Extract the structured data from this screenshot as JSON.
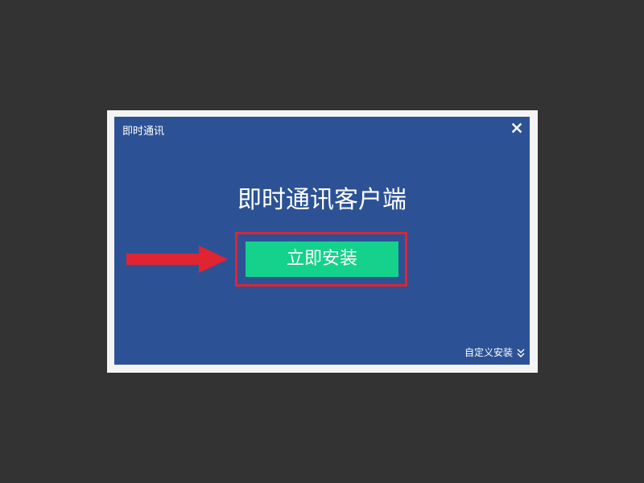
{
  "dialog": {
    "window_title": "即时通讯",
    "main_title": "即时通讯客户端",
    "install_button_label": "立即安装",
    "custom_install_label": "自定义安装"
  },
  "icons": {
    "close": "close-icon",
    "custom_install_chevron": "double-chevron-down-icon",
    "annotation_arrow": "arrow-right-icon"
  },
  "colors": {
    "backdrop": "#333333",
    "dialog_background": "#2c5295",
    "install_button": "#14d28b",
    "annotation_red": "#e02431"
  }
}
